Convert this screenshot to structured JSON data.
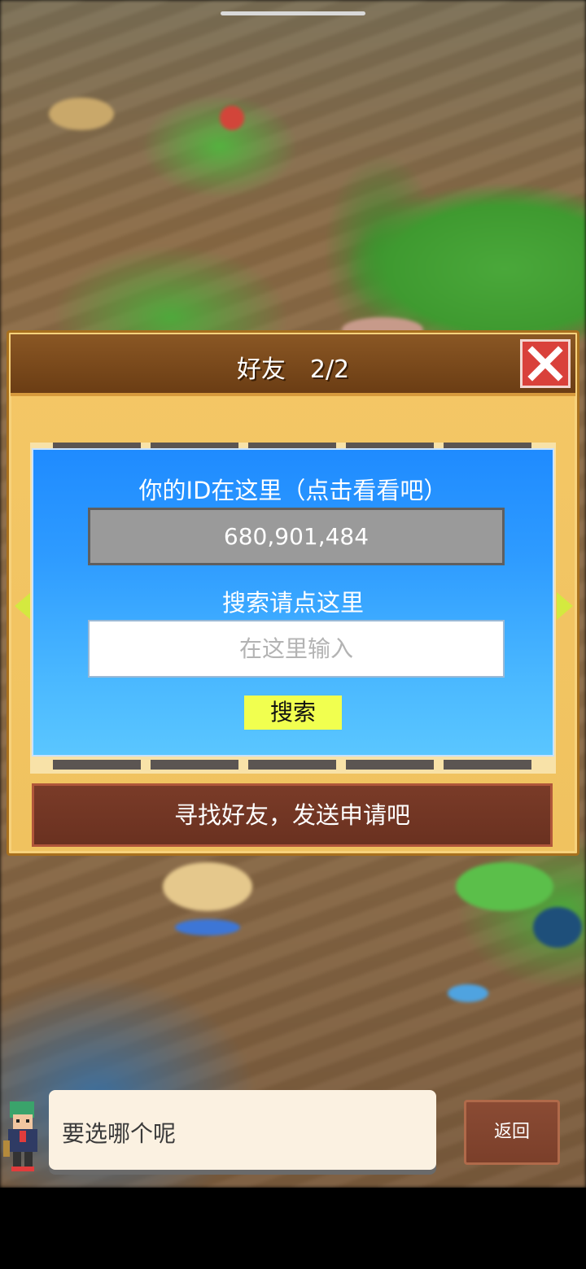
{
  "dialog": {
    "title": "好友　2/2",
    "close_icon": "close-x-icon"
  },
  "panel": {
    "id_label": "你的ID在这里（点击看看吧）",
    "user_id": "680,901,484",
    "search_label": "搜索请点这里",
    "search_placeholder": "在这里输入",
    "search_button": "搜索"
  },
  "find_friends_button": "寻找好友，发送申请吧",
  "nav": {
    "prev_icon": "arrow-left-icon",
    "next_icon": "arrow-right-icon"
  },
  "chat": {
    "message": "要选哪个呢"
  },
  "back_button": "返回",
  "colors": {
    "panel_blue": "#2e9bff",
    "close_red": "#d9413b",
    "search_yellow": "#f1ff4f",
    "button_brown": "#6a3120"
  }
}
